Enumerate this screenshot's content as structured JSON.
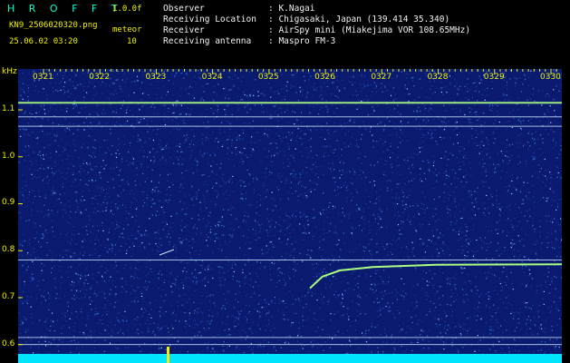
{
  "header": {
    "app_title": "H R O F F T",
    "version": "1.0.0f",
    "filename": "KN9_2506020320.png",
    "datetime": "25.06.02 03:20",
    "meteor_label": "meteor",
    "meteor_count": "10",
    "observer_key": "Observer",
    "observer_val": ": K.Nagai",
    "location_key": "Receiving Location",
    "location_val": ": Chigasaki, Japan (139.414 35.340)",
    "receiver_key": "Receiver",
    "receiver_val": ": AirSpy mini (Miakejima VOR 108.65MHz)",
    "antenna_key": "Receiving antenna",
    "antenna_val": ": Maspro FM-3"
  },
  "chart_data": {
    "type": "heatmap",
    "ylabel": "kHz",
    "x_ticks": [
      "0321",
      "0322",
      "0323",
      "0324",
      "0325",
      "0326",
      "0327",
      "0328",
      "0329",
      "0330"
    ],
    "y_ticks": [
      "1.1",
      "1.0",
      "0.9",
      "0.8",
      "0.7",
      "0.6"
    ],
    "ylim": [
      0.58,
      1.16
    ],
    "horizontal_lines_khz": [
      1.115,
      1.085,
      1.065,
      0.78,
      0.615,
      0.6
    ],
    "meteor_trail": [
      {
        "x": 0.0,
        "y": 0.72
      },
      {
        "x": 0.05,
        "y": 0.745
      },
      {
        "x": 0.12,
        "y": 0.758
      },
      {
        "x": 0.25,
        "y": 0.765
      },
      {
        "x": 0.5,
        "y": 0.77
      },
      {
        "x": 1.0,
        "y": 0.771
      }
    ],
    "colors": {
      "background": "#0a1a6e",
      "noise": "#3a7adf",
      "line": "#c8e8ff",
      "strong": "#aaff80",
      "floor": "#00e5ff"
    }
  }
}
